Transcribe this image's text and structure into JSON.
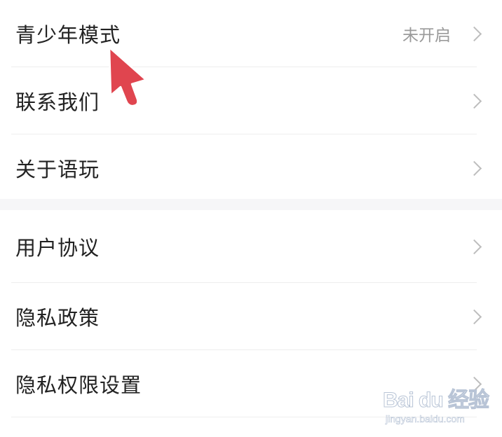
{
  "settings": {
    "group1": [
      {
        "label": "青少年模式",
        "value": "未开启"
      },
      {
        "label": "联系我们",
        "value": ""
      },
      {
        "label": "关于语玩",
        "value": ""
      }
    ],
    "group2": [
      {
        "label": "用户协议",
        "value": ""
      },
      {
        "label": "隐私政策",
        "value": ""
      },
      {
        "label": "隐私权限设置",
        "value": ""
      }
    ]
  },
  "watermark": {
    "brand": "Bai du 经验",
    "url": "jingyan.baidu.com"
  },
  "colors": {
    "cursor": "#e0454f",
    "text": "#222222",
    "secondary_text": "#9a9a9a",
    "separator": "#f6f6f8"
  },
  "icons": {
    "row_arrow": "chevron-right-icon",
    "pointer": "mouse-pointer-icon"
  }
}
